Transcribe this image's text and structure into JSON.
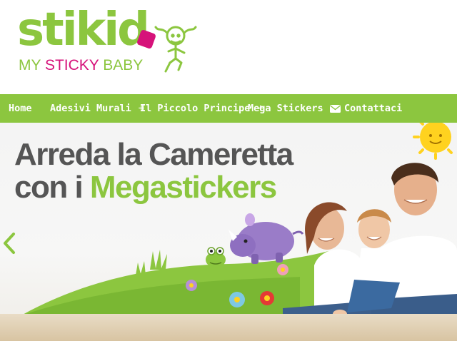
{
  "logo": {
    "word": "stikid",
    "tagline_my": "MY",
    "tagline_sticky": "STICKY",
    "tagline_baby": "BABY"
  },
  "nav": {
    "items": [
      {
        "label": "Home"
      },
      {
        "label": "Adesivi Murali",
        "plus": "+"
      },
      {
        "label": "Il Piccolo Principe",
        "plus": "+"
      },
      {
        "label": "Mega Stickers"
      },
      {
        "label": "Contattaci",
        "icon": "envelope-icon"
      }
    ]
  },
  "hero": {
    "title_line1": "Arreda la Cameretta",
    "title_prefix": "con i ",
    "title_accent": "Megastickers"
  },
  "colors": {
    "brand_green": "#8cc63f",
    "brand_pink": "#d6127a",
    "text_gray": "#555555"
  }
}
